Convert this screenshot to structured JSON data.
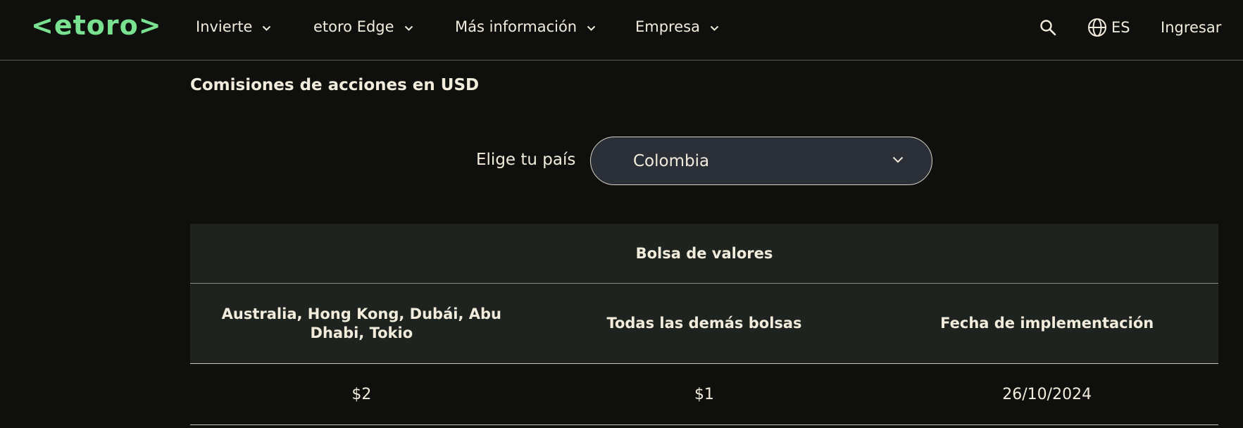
{
  "header": {
    "logo_text": "<etoro>",
    "nav": [
      {
        "label": "Invierte"
      },
      {
        "label": "etoro Edge"
      },
      {
        "label": "Más información"
      },
      {
        "label": "Empresa"
      }
    ],
    "language": "ES",
    "login_label": "Ingresar",
    "icons": [
      "search-icon",
      "globe-icon",
      "chevron-down-icon"
    ]
  },
  "main": {
    "section_title": "Comisiones de acciones en USD",
    "country_label": "Elige tu país",
    "country_selected": "Colombia",
    "table": {
      "group_header": "Bolsa de valores",
      "columns": [
        "Australia, Hong Kong, Dubái, Abu Dhabi, Tokio",
        "Todas las demás bolsas",
        "Fecha de implementación"
      ],
      "rows": [
        [
          "$2",
          "$1",
          "26/10/2024"
        ]
      ]
    }
  },
  "colors": {
    "background": "#0f100e",
    "brand_green": "#79e18f",
    "text": "#f1ecdc",
    "table_header_bg": "#1f231f",
    "select_bg": "#2b2f38"
  }
}
